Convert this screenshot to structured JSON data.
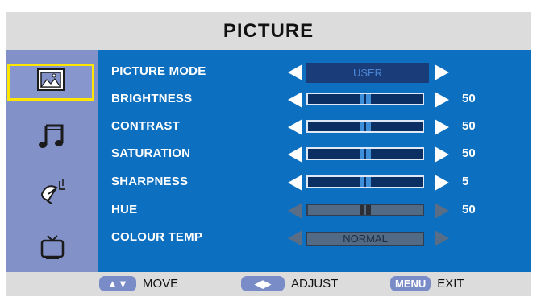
{
  "menu": {
    "title": "PICTURE"
  },
  "sidebar": {
    "items": [
      {
        "icon": "picture-icon",
        "selected": true
      },
      {
        "icon": "music-note-icon",
        "selected": false
      },
      {
        "icon": "satellite-dish-icon",
        "selected": false
      },
      {
        "icon": "tv-icon",
        "selected": false
      }
    ]
  },
  "settings": [
    {
      "label": "PICTURE MODE",
      "type": "select",
      "option": "USER",
      "enabled": true
    },
    {
      "label": "BRIGHTNESS",
      "type": "slider",
      "value": "50",
      "level": 0.5,
      "enabled": true
    },
    {
      "label": "CONTRAST",
      "type": "slider",
      "value": "50",
      "level": 0.5,
      "enabled": true
    },
    {
      "label": "SATURATION",
      "type": "slider",
      "value": "50",
      "level": 0.5,
      "enabled": true
    },
    {
      "label": "SHARPNESS",
      "type": "slider",
      "value": "5",
      "level": 0.5,
      "enabled": true
    },
    {
      "label": "HUE",
      "type": "slider",
      "value": "50",
      "level": 0.5,
      "enabled": false
    },
    {
      "label": "COLOUR TEMP",
      "type": "select",
      "option": "NORMAL",
      "enabled": false
    }
  ],
  "footer": {
    "move": {
      "key": "▲▼",
      "label": "MOVE"
    },
    "adjust": {
      "key": "◀▶",
      "label": "ADJUST"
    },
    "exit": {
      "key": "MENU",
      "label": "EXIT"
    }
  },
  "colors": {
    "panel_blue": "#0d6fbf",
    "sidebar": "#8291c8",
    "selection": "#ffe600"
  }
}
